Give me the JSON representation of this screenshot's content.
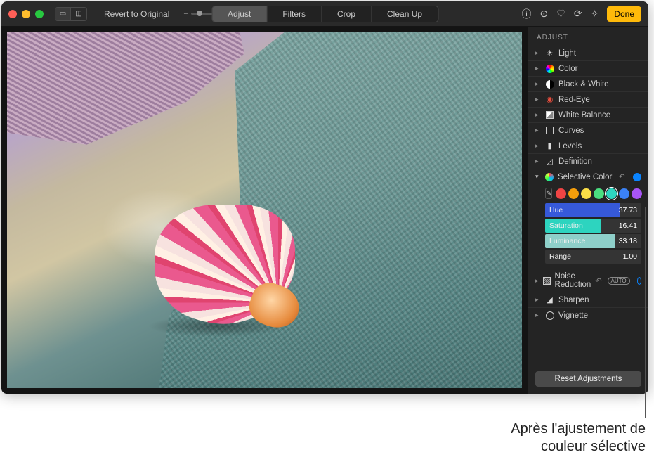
{
  "toolbar": {
    "revert": "Revert to Original",
    "tabs": [
      "Adjust",
      "Filters",
      "Crop",
      "Clean Up"
    ],
    "active_tab": 0,
    "done": "Done"
  },
  "sidebar": {
    "header": "ADJUST",
    "items": [
      {
        "label": "Light",
        "icon": "sun"
      },
      {
        "label": "Color",
        "icon": "colorwheel"
      },
      {
        "label": "Black & White",
        "icon": "bw"
      },
      {
        "label": "Red-Eye",
        "icon": "redeye"
      },
      {
        "label": "White Balance",
        "icon": "wb"
      },
      {
        "label": "Curves",
        "icon": "curves"
      },
      {
        "label": "Levels",
        "icon": "levels"
      },
      {
        "label": "Definition",
        "icon": "definition"
      }
    ],
    "selective": {
      "label": "Selective Color",
      "swatches": [
        "#ef4444",
        "#f59e0b",
        "#fde047",
        "#4ade80",
        "#2dd4bf",
        "#3b82f6",
        "#a855f7"
      ],
      "selected_swatch": 4,
      "sliders": [
        {
          "name": "Hue",
          "value": "37.73",
          "fill": 0.78,
          "color": "#3659d9"
        },
        {
          "name": "Saturation",
          "value": "16.41",
          "fill": 0.58,
          "color": "#2dd4bf"
        },
        {
          "name": "Luminance",
          "value": "33.18",
          "fill": 0.72,
          "color": "#8ecfc9"
        },
        {
          "name": "Range",
          "value": "1.00",
          "fill": 0.0,
          "color": "#555"
        }
      ]
    },
    "items_after": [
      {
        "label": "Noise Reduction",
        "icon": "noise",
        "auto": true
      },
      {
        "label": "Sharpen",
        "icon": "sharpen"
      },
      {
        "label": "Vignette",
        "icon": "vignette"
      }
    ],
    "reset": "Reset Adjustments"
  },
  "caption_line1": "Après l'ajustement de",
  "caption_line2": "couleur sélective"
}
